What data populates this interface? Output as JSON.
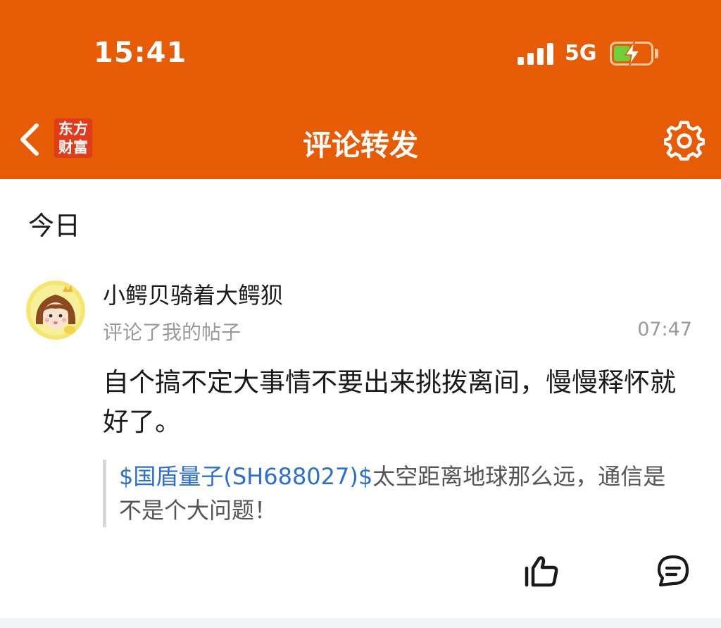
{
  "status_bar": {
    "time": "15:41",
    "network": "5G",
    "battery_level": 0.45
  },
  "header": {
    "title": "评论转发",
    "logo_line1": "东方",
    "logo_line2": "财富",
    "icons": [
      "back-icon",
      "gear-icon"
    ]
  },
  "section": {
    "title": "今日"
  },
  "notification": {
    "username": "小鳄贝骑着大鳄狈",
    "action": "评论了我的帖子",
    "time": "07:47",
    "comment": "自个搞不定大事情不要出来挑拨离间，慢慢释怀就好了。",
    "quote": {
      "stock_link": "$国盾量子(SH688027)$",
      "text": "太空距离地球那么远，通信是不是个大问题！"
    },
    "actions": [
      "like-icon",
      "reply-icon"
    ]
  },
  "colors": {
    "header_bg": "#e85b05",
    "link": "#2a6ed6",
    "logo_bg": "#e23b1b"
  }
}
